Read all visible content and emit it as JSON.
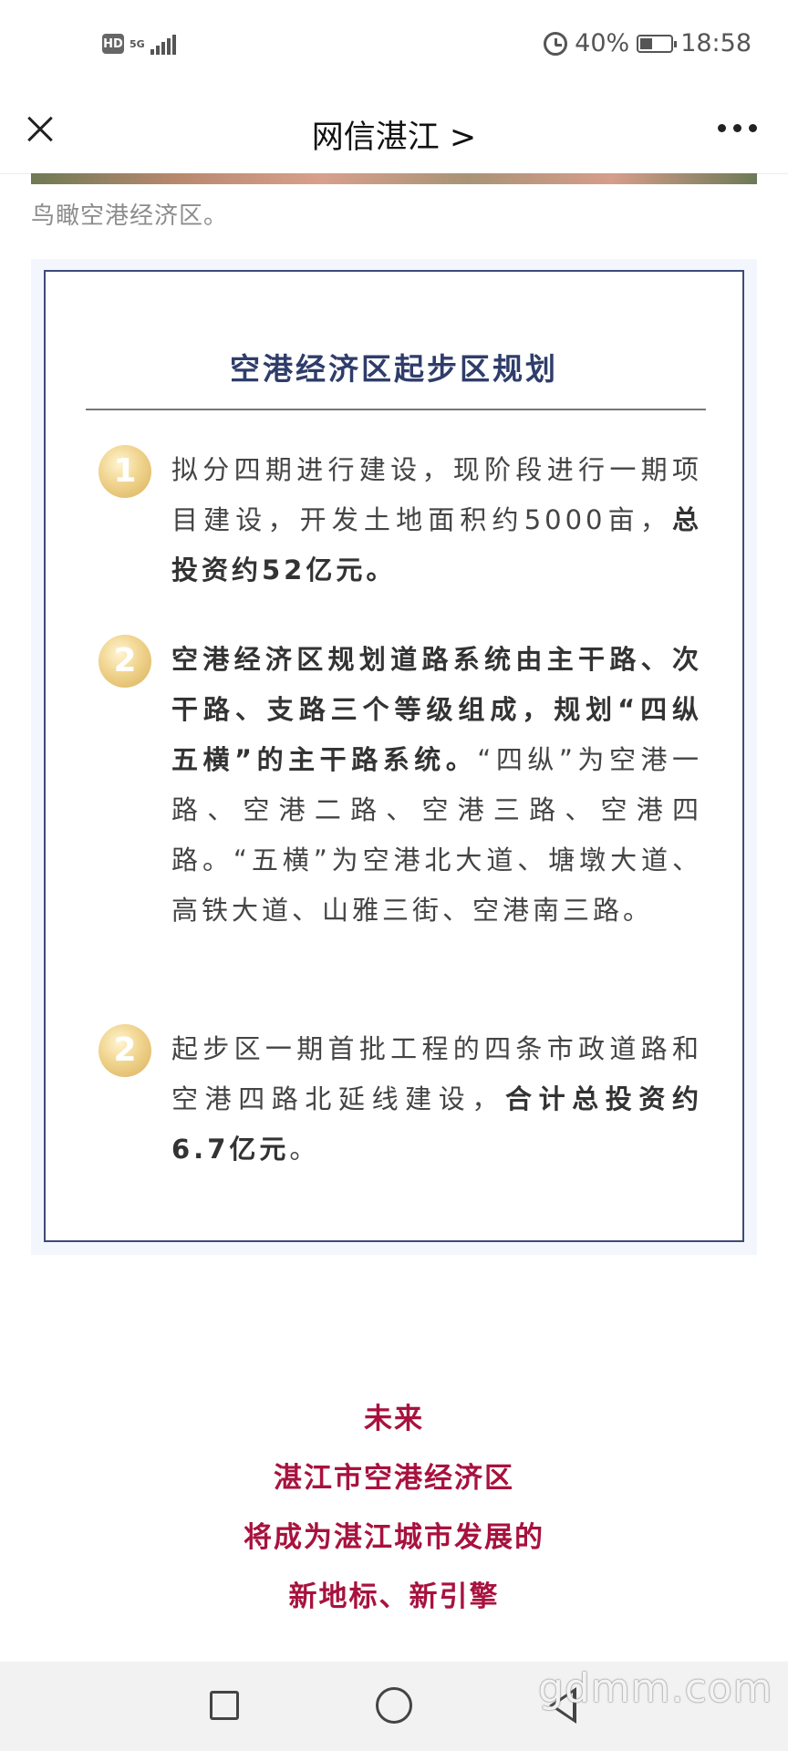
{
  "status_bar": {
    "hd_label": "HD",
    "network": "5G",
    "battery_percent": "40%",
    "battery_level": 0.4,
    "time": "18:58"
  },
  "nav": {
    "title": "网信湛江 >",
    "close_icon": "close-icon",
    "more_icon": "more-icon"
  },
  "caption": "鸟瞰空港经济区。",
  "card": {
    "title": "空港经济区起步区规划",
    "items": [
      {
        "number": "1",
        "text_plain": "拟分四期进行建设，现阶段进行一期项目建设，开发土地面积约5000亩，",
        "text_bold": "总投资约52亿元。",
        "text_after": ""
      },
      {
        "number": "2",
        "text_plain": "",
        "text_bold": "空港经济区规划道路系统由主干路、次干路、支路三个等级组成，规划“四纵五横”的主干路系统。",
        "text_after": "“四纵”为空港一路、空港二路、空港三路、空港四路。“五横”为空港北大道、塘墩大道、高铁大道、山雅三街、空港南三路。"
      },
      {
        "number": "2",
        "text_plain": "起步区一期首批工程的四条市政道路和空港四路北延线建设，",
        "text_bold": "合计总投资约6.7亿元",
        "text_after": "。"
      }
    ]
  },
  "conclusion": {
    "lines": [
      "未来",
      "湛江市空港经济区",
      "将成为湛江城市发展的",
      "新地标、新引擎"
    ]
  },
  "watermark": "gdmm.com",
  "colors": {
    "card_border": "#3e4a78",
    "card_title": "#2f3d6b",
    "conclusion": "#a8123e",
    "badge": "#e3bf6b"
  }
}
